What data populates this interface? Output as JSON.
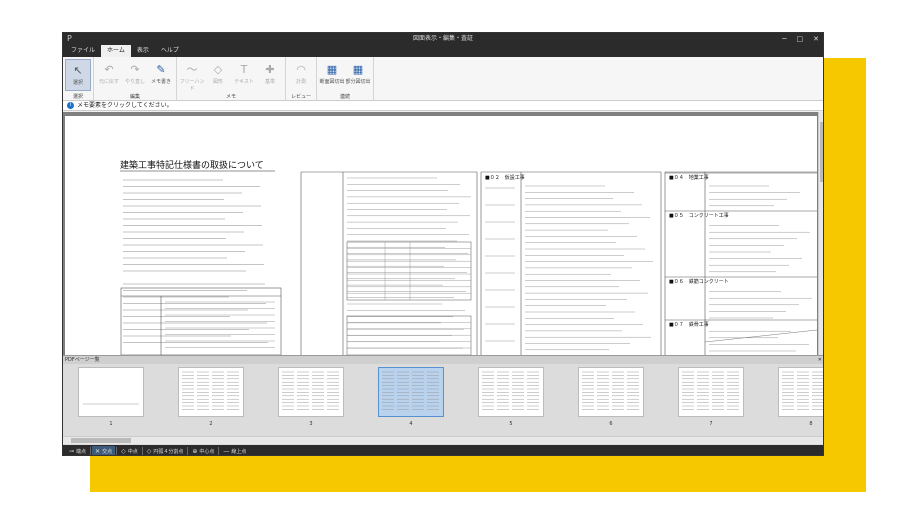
{
  "window": {
    "title": "図面表示・編集・査証",
    "app_icon": "P"
  },
  "window_controls": {
    "minimize": "─",
    "maximize": "□",
    "close": "✕"
  },
  "menu": [
    "ファイル",
    "ホーム",
    "表示",
    "ヘルプ"
  ],
  "ribbon": {
    "groups": [
      {
        "label": "選択",
        "buttons": [
          {
            "label": "選択",
            "icon": "cursor-icon",
            "glyph": "↖",
            "state": "selected"
          }
        ]
      },
      {
        "label": "編集",
        "buttons": [
          {
            "label": "元に戻す",
            "icon": "undo-icon",
            "glyph": "↶",
            "state": "disabled"
          },
          {
            "label": "やり直し",
            "icon": "redo-icon",
            "glyph": "↷",
            "state": "disabled"
          },
          {
            "label": "メモ書き",
            "icon": "memo-write-icon",
            "glyph": "✎",
            "state": "normal"
          }
        ]
      },
      {
        "label": "メモ",
        "buttons": [
          {
            "label": "フリーハンド",
            "icon": "freehand-icon",
            "glyph": "〜",
            "state": "disabled"
          },
          {
            "label": "図形",
            "icon": "shape-icon",
            "glyph": "◇",
            "state": "disabled"
          },
          {
            "label": "テキスト",
            "icon": "text-icon",
            "glyph": "T",
            "state": "disabled"
          },
          {
            "label": "基準",
            "icon": "stamp-icon",
            "glyph": "✚",
            "state": "disabled"
          }
        ]
      },
      {
        "label": "レビュー",
        "buttons": [
          {
            "label": "計測",
            "icon": "measure-icon",
            "glyph": "◠",
            "state": "disabled"
          }
        ]
      },
      {
        "label": "連続",
        "buttons": [
          {
            "label": "断面図切出",
            "icon": "section-cut-icon",
            "glyph": "▦",
            "state": "normal"
          },
          {
            "label": "部分図切出",
            "icon": "partial-cut-icon",
            "glyph": "▦",
            "state": "normal"
          }
        ]
      }
    ]
  },
  "info_message": "メモ要素をクリックしてください。",
  "document": {
    "title": "建築工事特記仕様書の取扱について",
    "sections": [
      {
        "heading": "■０２　仮設工事"
      },
      {
        "heading": "■０４　地業工事"
      },
      {
        "heading": "■０５　コンクリート工事"
      },
      {
        "heading": "■０６　鉄筋コンクリート"
      },
      {
        "heading": "■０７　鉄骨工事"
      }
    ]
  },
  "thumbnail_panel": {
    "title": "PDFページ一覧",
    "close": "✕",
    "pages": [
      {
        "num": "1",
        "selected": false
      },
      {
        "num": "2",
        "selected": false
      },
      {
        "num": "3",
        "selected": false
      },
      {
        "num": "4",
        "selected": true
      },
      {
        "num": "5",
        "selected": false
      },
      {
        "num": "6",
        "selected": false
      },
      {
        "num": "7",
        "selected": false
      },
      {
        "num": "8",
        "selected": false
      }
    ]
  },
  "statusbar": {
    "snaps": [
      {
        "label": "端点",
        "sym": "⊸",
        "active": false
      },
      {
        "label": "交点",
        "sym": "✕",
        "active": true
      },
      {
        "label": "中点",
        "sym": "◇",
        "active": false
      },
      {
        "label": "円弧４分割点",
        "sym": "◇",
        "active": false
      },
      {
        "label": "中心点",
        "sym": "⊕",
        "active": false
      },
      {
        "label": "線上点",
        "sym": "—",
        "active": false
      }
    ]
  },
  "colors": {
    "accent": "#f5c800",
    "chrome": "#2b2b2b",
    "selection": "#b9d2ee"
  }
}
